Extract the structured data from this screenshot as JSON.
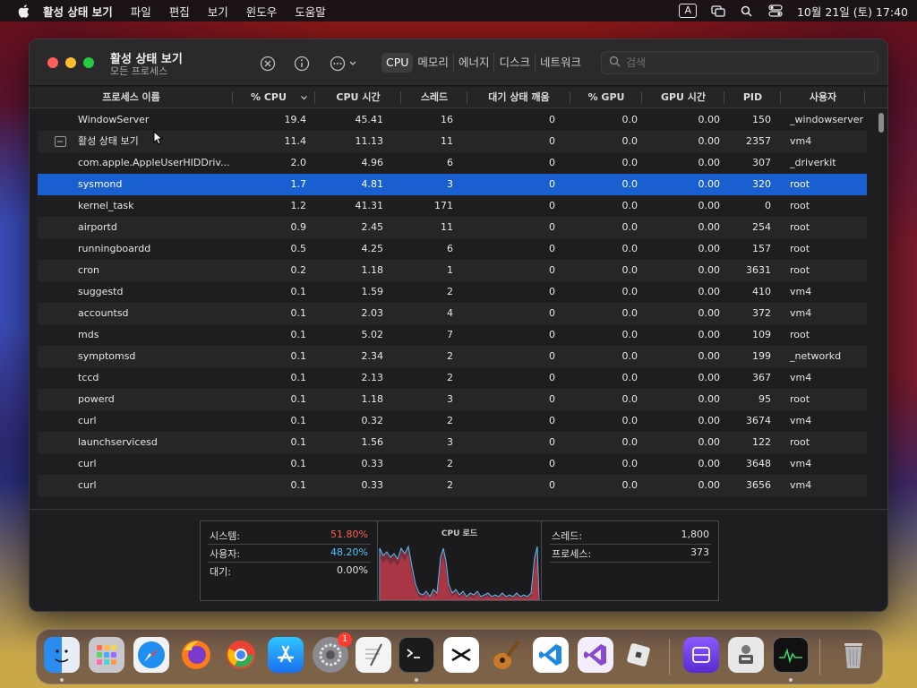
{
  "menubar": {
    "app": "활성 상태 보기",
    "items": [
      "파일",
      "편집",
      "보기",
      "윈도우",
      "도움말"
    ],
    "input_indicator": "A",
    "clock": "10월 21일 (토) 17:40"
  },
  "window": {
    "title": "활성 상태 보기",
    "subtitle": "모든 프로세스",
    "tabs": [
      "CPU",
      "메모리",
      "에너지",
      "디스크",
      "네트워크"
    ],
    "active_tab": "CPU",
    "search_placeholder": "검색"
  },
  "table": {
    "columns": [
      "프로세스 이름",
      "% CPU",
      "CPU 시간",
      "스레드",
      "대기 상태 깨움",
      "% GPU",
      "GPU 시간",
      "PID",
      "사용자"
    ],
    "rows": [
      {
        "name": "WindowServer",
        "cpu": "19.4",
        "time": "45.41",
        "threads": "16",
        "wakes": "0",
        "gpu": "0.0",
        "gputime": "0.00",
        "pid": "150",
        "user": "_windowserver"
      },
      {
        "name": "활성 상태 보기",
        "cpu": "11.4",
        "time": "11.13",
        "threads": "11",
        "wakes": "0",
        "gpu": "0.0",
        "gputime": "0.00",
        "pid": "2357",
        "user": "vm4"
      },
      {
        "name": "com.apple.AppleUserHIDDriv...",
        "cpu": "2.0",
        "time": "4.96",
        "threads": "6",
        "wakes": "0",
        "gpu": "0.0",
        "gputime": "0.00",
        "pid": "307",
        "user": "_driverkit"
      },
      {
        "name": "sysmond",
        "cpu": "1.7",
        "time": "4.81",
        "threads": "3",
        "wakes": "0",
        "gpu": "0.0",
        "gputime": "0.00",
        "pid": "320",
        "user": "root"
      },
      {
        "name": "kernel_task",
        "cpu": "1.2",
        "time": "41.31",
        "threads": "171",
        "wakes": "0",
        "gpu": "0.0",
        "gputime": "0.00",
        "pid": "0",
        "user": "root"
      },
      {
        "name": "airportd",
        "cpu": "0.9",
        "time": "2.45",
        "threads": "11",
        "wakes": "0",
        "gpu": "0.0",
        "gputime": "0.00",
        "pid": "254",
        "user": "root"
      },
      {
        "name": "runningboardd",
        "cpu": "0.5",
        "time": "4.25",
        "threads": "6",
        "wakes": "0",
        "gpu": "0.0",
        "gputime": "0.00",
        "pid": "157",
        "user": "root"
      },
      {
        "name": "cron",
        "cpu": "0.2",
        "time": "1.18",
        "threads": "1",
        "wakes": "0",
        "gpu": "0.0",
        "gputime": "0.00",
        "pid": "3631",
        "user": "root"
      },
      {
        "name": "suggestd",
        "cpu": "0.1",
        "time": "1.59",
        "threads": "2",
        "wakes": "0",
        "gpu": "0.0",
        "gputime": "0.00",
        "pid": "410",
        "user": "vm4"
      },
      {
        "name": "accountsd",
        "cpu": "0.1",
        "time": "2.03",
        "threads": "4",
        "wakes": "0",
        "gpu": "0.0",
        "gputime": "0.00",
        "pid": "372",
        "user": "vm4"
      },
      {
        "name": "mds",
        "cpu": "0.1",
        "time": "5.02",
        "threads": "7",
        "wakes": "0",
        "gpu": "0.0",
        "gputime": "0.00",
        "pid": "109",
        "user": "root"
      },
      {
        "name": "symptomsd",
        "cpu": "0.1",
        "time": "2.34",
        "threads": "2",
        "wakes": "0",
        "gpu": "0.0",
        "gputime": "0.00",
        "pid": "199",
        "user": "_networkd"
      },
      {
        "name": "tccd",
        "cpu": "0.1",
        "time": "2.13",
        "threads": "2",
        "wakes": "0",
        "gpu": "0.0",
        "gputime": "0.00",
        "pid": "367",
        "user": "vm4"
      },
      {
        "name": "powerd",
        "cpu": "0.1",
        "time": "1.18",
        "threads": "3",
        "wakes": "0",
        "gpu": "0.0",
        "gputime": "0.00",
        "pid": "95",
        "user": "root"
      },
      {
        "name": "curl",
        "cpu": "0.1",
        "time": "0.32",
        "threads": "2",
        "wakes": "0",
        "gpu": "0.0",
        "gputime": "0.00",
        "pid": "3674",
        "user": "vm4"
      },
      {
        "name": "launchservicesd",
        "cpu": "0.1",
        "time": "1.56",
        "threads": "3",
        "wakes": "0",
        "gpu": "0.0",
        "gputime": "0.00",
        "pid": "122",
        "user": "root"
      },
      {
        "name": "curl",
        "cpu": "0.1",
        "time": "0.33",
        "threads": "2",
        "wakes": "0",
        "gpu": "0.0",
        "gputime": "0.00",
        "pid": "3648",
        "user": "vm4"
      },
      {
        "name": "curl",
        "cpu": "0.1",
        "time": "0.33",
        "threads": "2",
        "wakes": "0",
        "gpu": "0.0",
        "gputime": "0.00",
        "pid": "3656",
        "user": "vm4"
      }
    ],
    "selected_index": 3
  },
  "summary": {
    "system_label": "시스템:",
    "system_value": "51.80%",
    "user_label": "사용자:",
    "user_value": "48.20%",
    "idle_label": "대기:",
    "idle_value": "0.00%",
    "graph_title": "CPU 로드",
    "threads_label": "스레드:",
    "threads_value": "1,800",
    "processes_label": "프로세스:",
    "processes_value": "373",
    "system_color": "#ff5b55",
    "user_color": "#4fc3f7"
  },
  "dock": {
    "apps": [
      "Finder",
      "Launchpad",
      "Safari",
      "Firefox",
      "Chrome",
      "App Store",
      "System Settings",
      "TextEdit",
      "Terminal",
      "CapCut",
      "GarageBand",
      "Visual Studio Code",
      "Visual Studio",
      "Roblox",
      "Apple Configurator",
      "Automator",
      "Activity Monitor",
      "Trash"
    ],
    "settings_badge": "1"
  }
}
